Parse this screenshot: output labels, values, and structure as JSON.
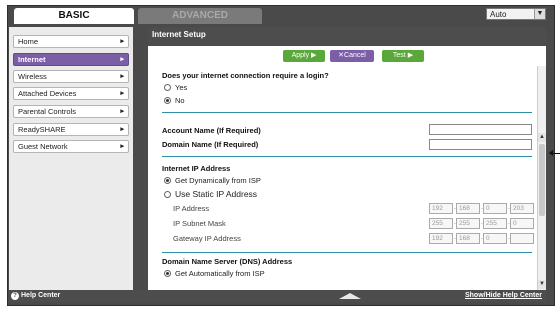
{
  "tabs": {
    "basic": "BASIC",
    "advanced": "ADVANCED"
  },
  "language": {
    "value": "Auto",
    "arrow": "▼"
  },
  "sidebar": {
    "items": [
      {
        "label": "Home",
        "chevron": "▸"
      },
      {
        "label": "Internet",
        "chevron": "▸"
      },
      {
        "label": "Wireless",
        "chevron": "▸"
      },
      {
        "label": "Attached Devices",
        "chevron": "▸"
      },
      {
        "label": "Parental Controls",
        "chevron": "▸"
      },
      {
        "label": "ReadySHARE",
        "chevron": "▸"
      },
      {
        "label": "Guest Network",
        "chevron": "▸"
      }
    ]
  },
  "main": {
    "title": "Internet Setup",
    "buttons": {
      "apply": "Apply ▶",
      "cancel": "✕Cancel",
      "test": "Test ▶"
    },
    "login_question": "Does your internet connection require a login?",
    "login_yes": "Yes",
    "login_no": "No",
    "account_name_label": "Account Name",
    "account_name_hint": "(If Required)",
    "domain_name_label": "Domain Name",
    "domain_name_hint": "(If Required)",
    "ip_section": "Internet IP Address",
    "ip_dynamic": "Get Dynamically from ISP",
    "ip_static": "Use Static IP Address",
    "ip_address_label": "IP Address",
    "ip_address": [
      "192",
      "168",
      "0",
      "203"
    ],
    "subnet_label": "IP Subnet Mask",
    "subnet": [
      "255",
      "255",
      "255",
      "0"
    ],
    "gateway_label": "Gateway IP Address",
    "gateway": [
      "192",
      "168",
      "0",
      ""
    ],
    "dns_section": "Domain Name Server (DNS) Address",
    "dns_auto": "Get Automatically from ISP"
  },
  "scrollbar": {
    "up": "▲",
    "down": "▼"
  },
  "footer": {
    "help_center": "Help Center",
    "help_icon": "?",
    "show_hide": "Show/Hide Help Center"
  }
}
